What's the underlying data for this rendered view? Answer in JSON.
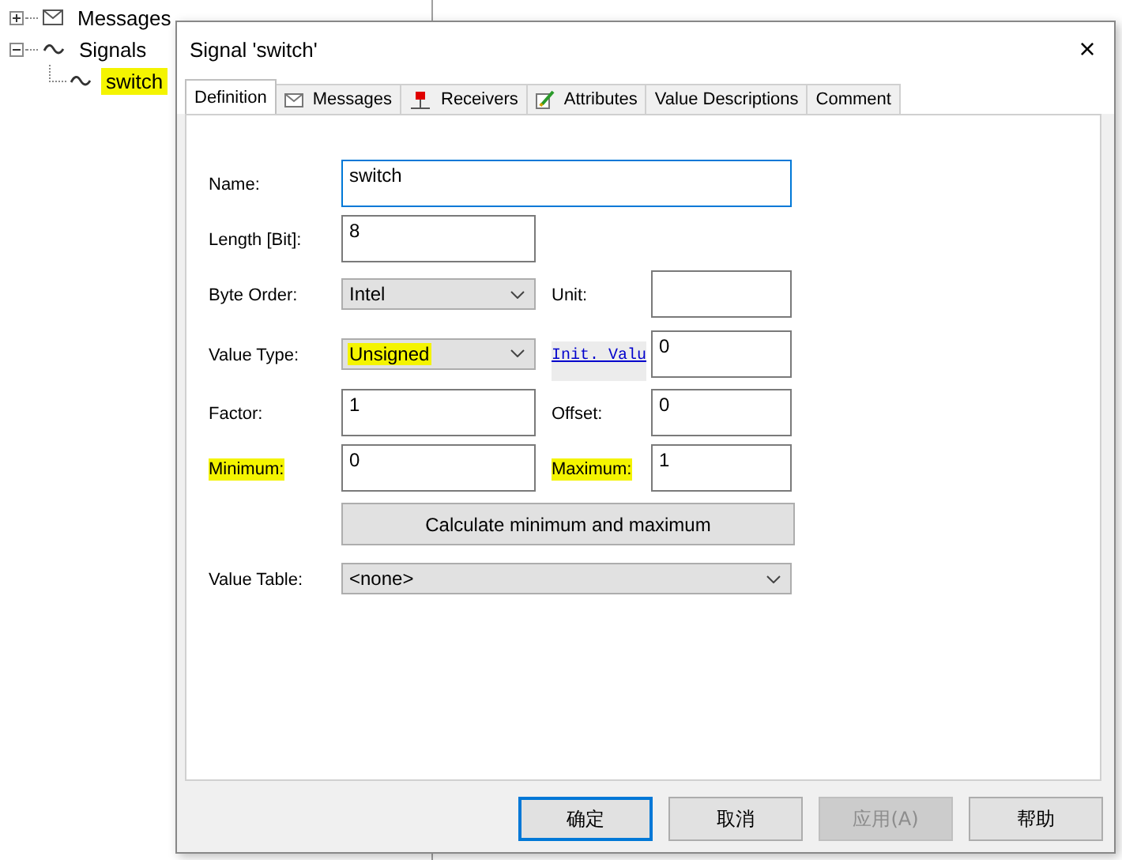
{
  "tree": [
    {
      "label": "Messages",
      "expanded": false
    },
    {
      "label": "Signals",
      "expanded": true,
      "children": [
        {
          "label": "switch",
          "highlighted": true
        }
      ]
    }
  ],
  "dialog": {
    "title": "Signal 'switch'",
    "close": "×",
    "tabs": [
      {
        "label": "Definition",
        "selected": true
      },
      {
        "label": "Messages",
        "selected": false
      },
      {
        "label": "Receivers",
        "selected": false
      },
      {
        "label": "Attributes",
        "selected": false
      },
      {
        "label": "Value Descriptions",
        "selected": false
      },
      {
        "label": "Comment",
        "selected": false
      }
    ],
    "rows": [
      {
        "kind": "field",
        "label": "Name:",
        "highlighted": false,
        "field": {
          "kind": "text",
          "value": "switch",
          "focused": true
        }
      },
      {
        "kind": "field",
        "label": "Length [Bit]:",
        "highlighted": false,
        "field": {
          "kind": "text",
          "value": "8",
          "focused": false
        }
      },
      {
        "kind": "field",
        "label": "Byte Order:",
        "highlighted": false,
        "field": {
          "kind": "combo",
          "value": "Intel",
          "highlighted": false
        },
        "right": {
          "kind": "label",
          "label": "Unit:",
          "highlighted": false
        }
      },
      {
        "kind": "field",
        "label": "Value Type:",
        "highlighted": false,
        "field": {
          "kind": "combo",
          "value": "Unsigned",
          "highlighted": true
        },
        "right": {
          "kind": "link",
          "label": "Init. Valu",
          "field": {
            "value": "0"
          }
        }
      },
      {
        "kind": "field",
        "label": "Factor:",
        "highlighted": false,
        "field": {
          "kind": "text",
          "value": "1",
          "focused": false
        },
        "right": {
          "kind": "label",
          "label": "Offset:",
          "highlighted": false,
          "field": {
            "value": "0"
          }
        }
      },
      {
        "kind": "field",
        "label": "Minimum:",
        "highlighted": true,
        "field": {
          "kind": "text",
          "value": "0",
          "focused": false
        },
        "right": {
          "kind": "label",
          "label": "Maximum:",
          "highlighted": true,
          "field": {
            "value": "1"
          }
        }
      },
      {
        "kind": "button",
        "label": "Calculate minimum and maximum"
      },
      {
        "kind": "field",
        "label": "Value Table:",
        "highlighted": false,
        "field": {
          "kind": "combo",
          "value": "<none>",
          "highlighted": false
        }
      }
    ],
    "buttons": [
      {
        "label": "确定",
        "focused": true,
        "disabled": false
      },
      {
        "label": "取消",
        "focused": false,
        "disabled": false
      },
      {
        "label": "应用(A)",
        "focused": false,
        "disabled": true
      },
      {
        "label": "帮助",
        "focused": false,
        "disabled": false
      }
    ]
  }
}
